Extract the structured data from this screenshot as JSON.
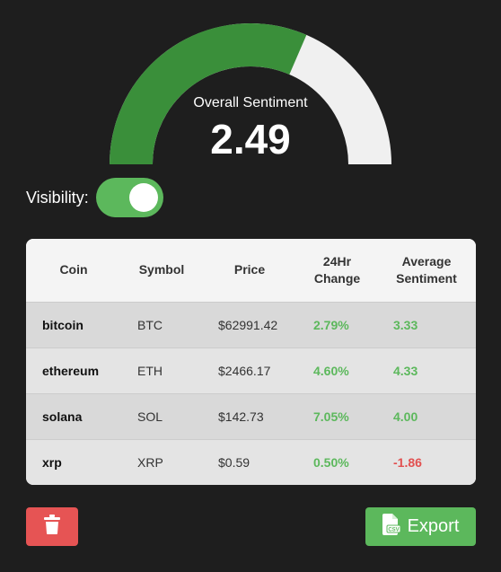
{
  "gauge": {
    "title": "Overall Sentiment",
    "value": "2.49",
    "fill_fraction": 0.63,
    "fill_color": "#3a8f3a",
    "track_color": "#f0f0f0"
  },
  "visibility": {
    "label": "Visibility:",
    "enabled": true,
    "color": "#5cb85c"
  },
  "table": {
    "headers": {
      "coin": "Coin",
      "symbol": "Symbol",
      "price": "Price",
      "change_line1": "24Hr",
      "change_line2": "Change",
      "sentiment_line1": "Average",
      "sentiment_line2": "Sentiment"
    },
    "rows": [
      {
        "coin": "bitcoin",
        "symbol": "BTC",
        "price": "$62991.42",
        "change": "2.79%",
        "sentiment": "3.33"
      },
      {
        "coin": "ethereum",
        "symbol": "ETH",
        "price": "$2466.17",
        "change": "4.60%",
        "sentiment": "4.33"
      },
      {
        "coin": "solana",
        "symbol": "SOL",
        "price": "$142.73",
        "change": "7.05%",
        "sentiment": "4.00"
      },
      {
        "coin": "xrp",
        "symbol": "XRP",
        "price": "$0.59",
        "change": "0.50%",
        "sentiment": "-1.86"
      }
    ]
  },
  "buttons": {
    "delete_icon": "trash-icon",
    "export_icon": "csv-file-icon",
    "export_label": "Export"
  },
  "colors": {
    "positive": "#5cb85c",
    "negative": "#e25050",
    "delete": "#e65454"
  }
}
